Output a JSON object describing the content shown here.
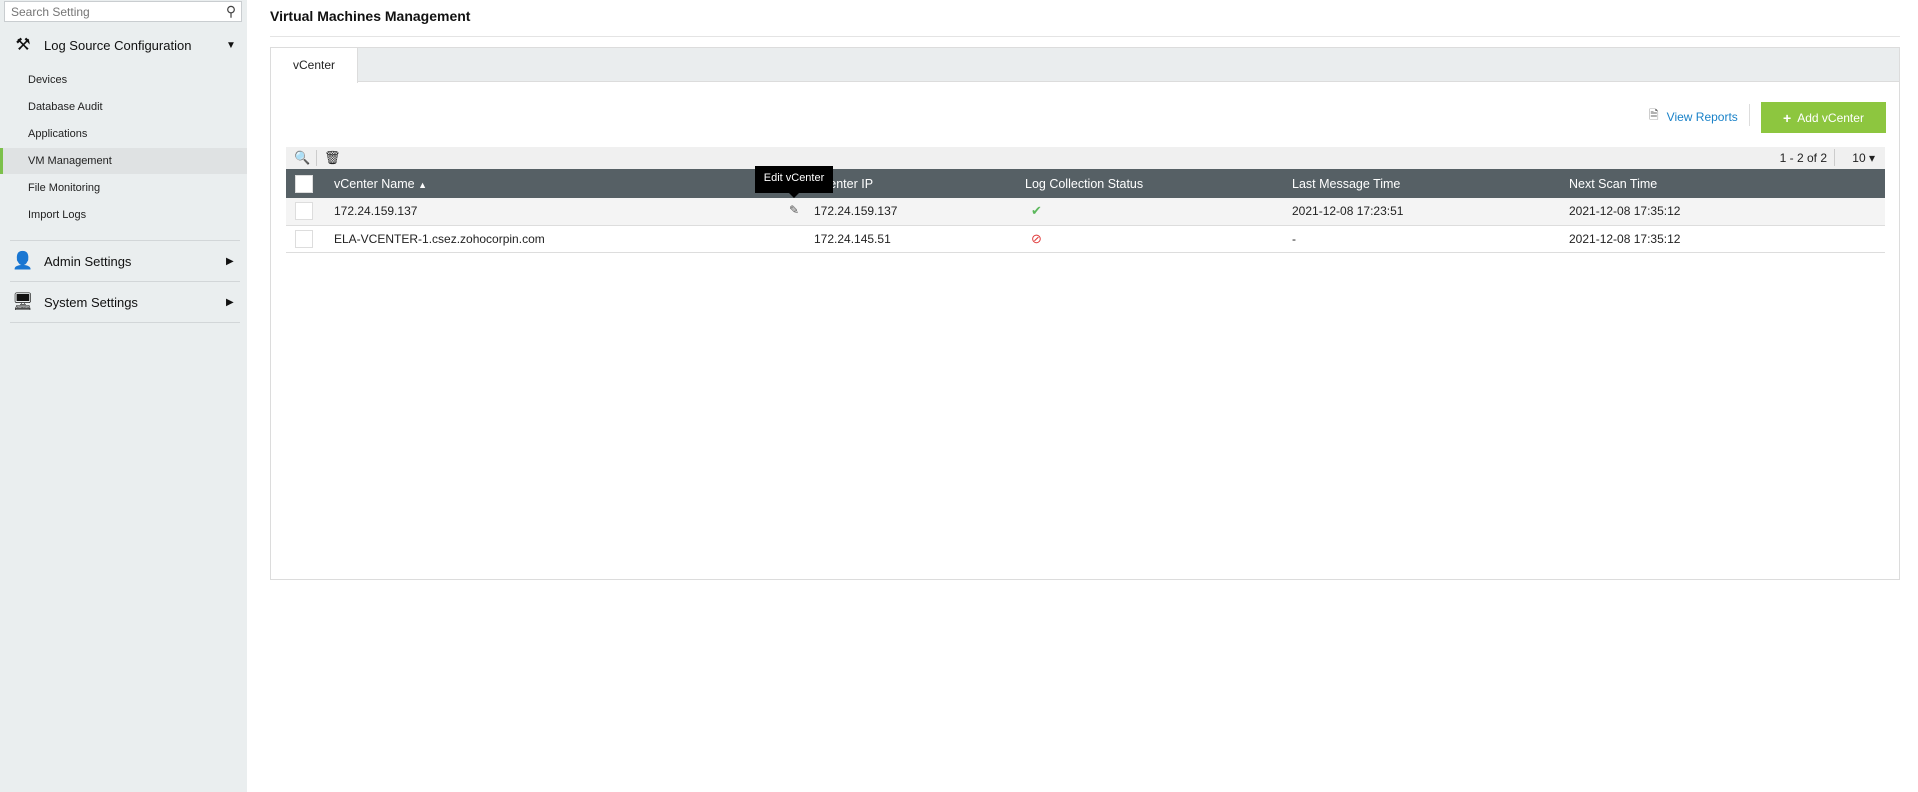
{
  "sidebar": {
    "search_placeholder": "Search Setting",
    "groups": [
      {
        "label": "Log Source Configuration",
        "icon": "tools-icon",
        "expanded": true
      },
      {
        "label": "Admin Settings",
        "icon": "admin-user-gear-icon"
      },
      {
        "label": "System Settings",
        "icon": "monitor-gear-icon"
      }
    ],
    "items": [
      {
        "label": "Devices"
      },
      {
        "label": "Database Audit"
      },
      {
        "label": "Applications"
      },
      {
        "label": "VM Management",
        "active": true
      },
      {
        "label": "File Monitoring"
      },
      {
        "label": "Import Logs"
      }
    ]
  },
  "page": {
    "title": "Virtual Machines Management",
    "tab": "vCenter",
    "view_reports": "View Reports",
    "add_vcenter": "Add vCenter",
    "accent": "#8dc63f"
  },
  "grid": {
    "pager": "1 - 2 of 2",
    "page_size": "10",
    "columns": [
      "vCenter Name",
      "vCenter IP",
      "Log Collection Status",
      "Last Message Time",
      "Next Scan Time"
    ],
    "tooltip": "Edit vCenter",
    "rows": [
      {
        "name": "172.24.159.137",
        "ip": "172.24.159.137",
        "status": "ok",
        "last": "2021-12-08 17:23:51",
        "next": "2021-12-08 17:35:12"
      },
      {
        "name": "ELA-VCENTER-1.csez.zohocorpin.com",
        "ip": "172.24.145.51",
        "status": "stopped",
        "last": "-",
        "next": "2021-12-08 17:35:12"
      }
    ]
  }
}
